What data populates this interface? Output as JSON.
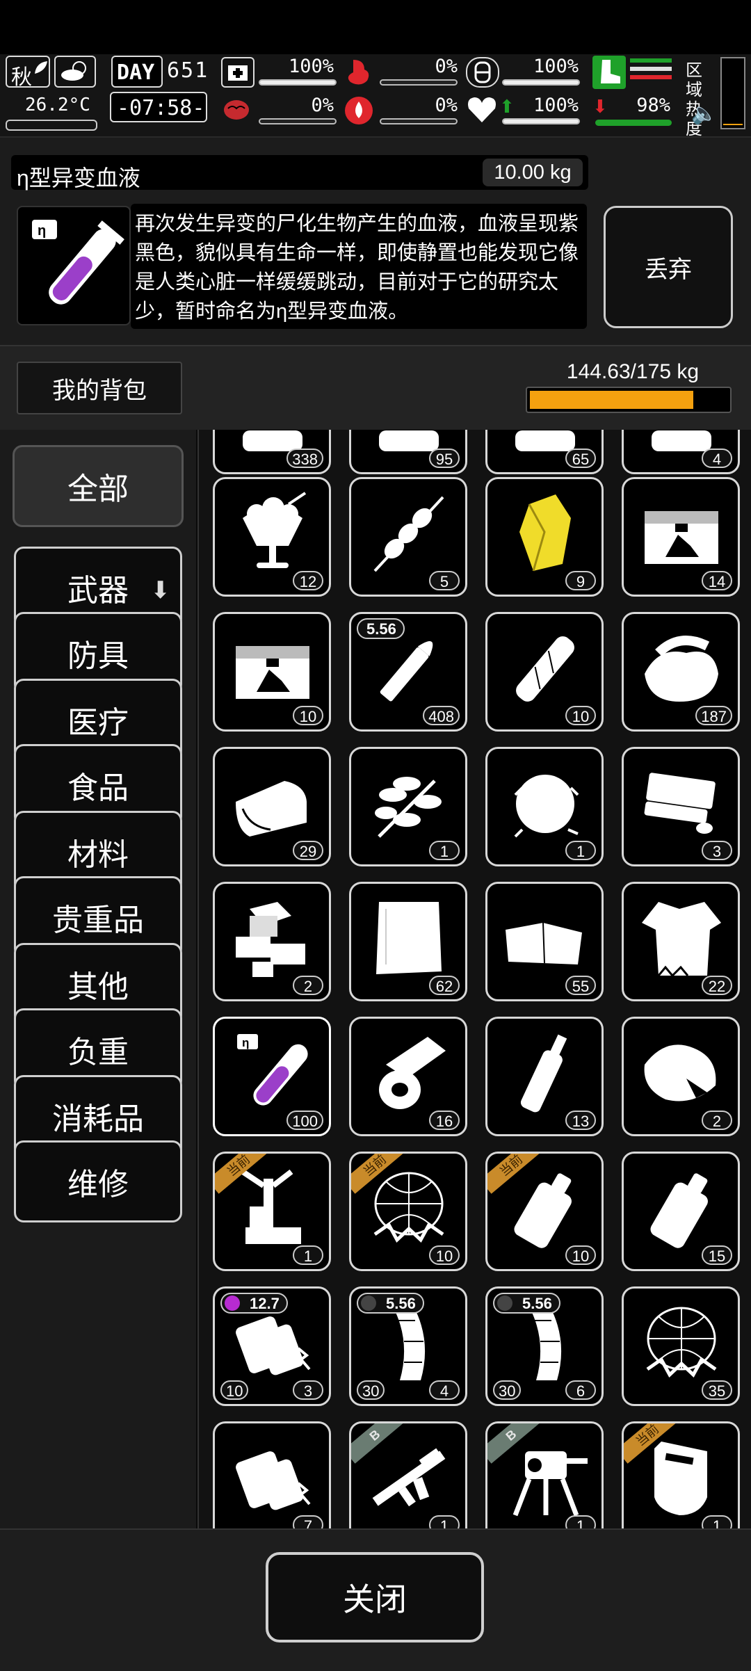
{
  "hud": {
    "season": "秋",
    "temperature": "26.2°C",
    "day_label": "DAY",
    "day_number": "651",
    "time": "-07:58-",
    "health_pct": "100%",
    "hunger_pct": "0%",
    "armor_pct": "100%",
    "brain_pct": "0%",
    "bleed_pct": "0%",
    "heart_pct": "100%",
    "stamina_pct": "98%",
    "zone_heat_label": "区域热度"
  },
  "item": {
    "name": "η型异变血液",
    "weight": "10.00 kg",
    "description": "再次发生异变的尸化生物产生的血液，血液呈现紫黑色，貌似具有生命一样，即使静置也能发现它像是人类心脏一样缓缓跳动，目前对于它的研究太少，暂时命名为η型异变血液。",
    "discard_label": "丢弃"
  },
  "backpack": {
    "label": "我的背包",
    "weight": "144.63/175 kg",
    "fill_fraction": 0.8265
  },
  "categories": [
    "全部",
    "武器",
    "防具",
    "医疗",
    "食品",
    "材料",
    "贵重品",
    "其他",
    "负重",
    "消耗品",
    "维修"
  ],
  "slots": [
    {
      "icon": "partial-icon",
      "count": "338"
    },
    {
      "icon": "partial-icon",
      "count": "95"
    },
    {
      "icon": "partial-icon",
      "count": "65"
    },
    {
      "icon": "partial-icon",
      "count": "4"
    },
    {
      "icon": "ice-cream-sundae-icon",
      "count": "12"
    },
    {
      "icon": "kebab-skewer-icon",
      "count": "5"
    },
    {
      "icon": "gold-crystal-icon",
      "count": "9"
    },
    {
      "icon": "supply-crate-icon",
      "count": "14"
    },
    {
      "icon": "supply-crate-icon",
      "count": "10"
    },
    {
      "icon": "bullet-icon",
      "count": "408",
      "caliber": "5.56"
    },
    {
      "icon": "bandage-roll-icon",
      "count": "10"
    },
    {
      "icon": "cloth-pile-icon",
      "count": "187"
    },
    {
      "icon": "towel-icon",
      "count": "29"
    },
    {
      "icon": "herb-branch-icon",
      "count": "1"
    },
    {
      "icon": "fiber-tuft-icon",
      "count": "1"
    },
    {
      "icon": "soap-bars-icon",
      "count": "3"
    },
    {
      "icon": "wood-blocks-icon",
      "count": "2"
    },
    {
      "icon": "fabric-sheet-icon",
      "count": "62"
    },
    {
      "icon": "folded-cloth-icon",
      "count": "55"
    },
    {
      "icon": "torn-shirt-icon",
      "count": "22"
    },
    {
      "icon": "mutant-blood-vial-icon",
      "count": "100"
    },
    {
      "icon": "tape-roll-icon",
      "count": "16"
    },
    {
      "icon": "bottle-icon",
      "count": "13"
    },
    {
      "icon": "food-bag-icon",
      "count": "2"
    },
    {
      "icon": "crafting-stand-icon",
      "count": "1",
      "tag": "当前"
    },
    {
      "icon": "wire-net-icon",
      "count": "10",
      "tag": "当前"
    },
    {
      "icon": "water-canister-icon",
      "count": "10",
      "tag": "当前"
    },
    {
      "icon": "water-canister-icon",
      "count": "15"
    },
    {
      "icon": "ammo-pouch-icon",
      "count": "3",
      "count2": "10",
      "caliber": "12.7"
    },
    {
      "icon": "rifle-magazine-icon",
      "count": "4",
      "count2": "30",
      "caliber": "5.56"
    },
    {
      "icon": "rifle-magazine-icon",
      "count": "6",
      "count2": "30",
      "caliber": "5.56"
    },
    {
      "icon": "wire-net-icon",
      "count": "35"
    },
    {
      "icon": "ammo-pouch-icon",
      "count": "7"
    },
    {
      "icon": "assault-rifle-icon",
      "count": "1",
      "tag": "B"
    },
    {
      "icon": "sentry-turret-icon",
      "count": "1",
      "tag": "B"
    },
    {
      "icon": "riot-shield-icon",
      "count": "1",
      "tag": "当前"
    }
  ],
  "close_label": "关闭",
  "colors": {
    "accent_orange": "#f5a10f",
    "stamina_green": "#1fa12a",
    "danger_red": "#e0262d",
    "blood_purple": "#9b3fc9"
  }
}
